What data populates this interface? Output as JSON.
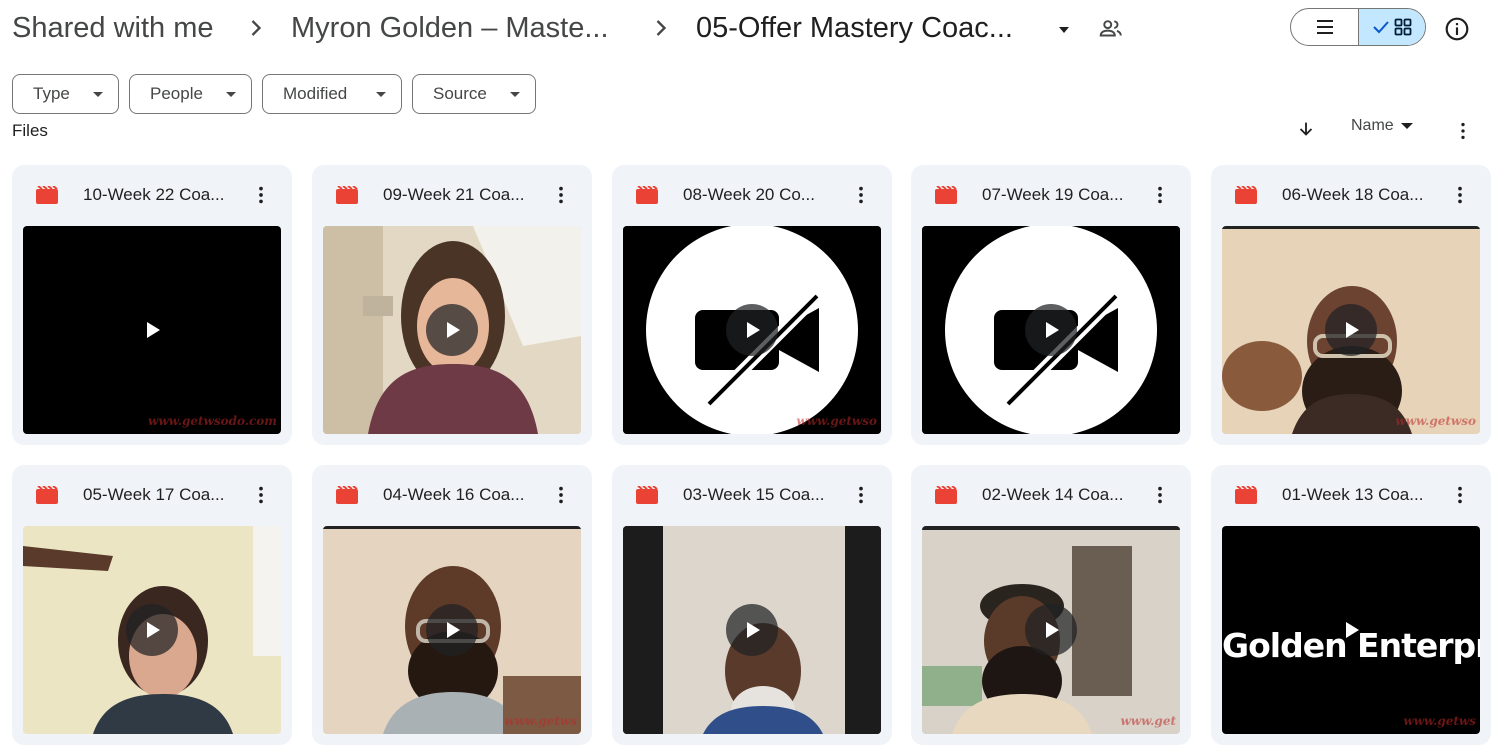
{
  "breadcrumb": {
    "root": "Shared with me",
    "parent": "Myron Golden – Maste...",
    "current": "05-Offer Mastery Coac..."
  },
  "filters": [
    "Type",
    "People",
    "Modified",
    "Source"
  ],
  "section_label": "Files",
  "sort": {
    "field": "Name"
  },
  "colors": {
    "accent_selected": "#c2e7ff",
    "card_bg": "#f0f4f9",
    "video_icon": "#ea4335"
  },
  "files": [
    {
      "title": "10-Week 22 Coa...",
      "watermark": "www.getwsodo.com"
    },
    {
      "title": "09-Week 21 Coa...",
      "watermark": ""
    },
    {
      "title": "08-Week 20 Co...",
      "watermark": "www.getwso"
    },
    {
      "title": "07-Week 19 Coa...",
      "watermark": ""
    },
    {
      "title": "06-Week 18 Coa...",
      "watermark": "www.getwso"
    },
    {
      "title": "05-Week 17 Coa...",
      "watermark": ""
    },
    {
      "title": "04-Week 16 Coa...",
      "watermark": "www.getws"
    },
    {
      "title": "03-Week 15 Coa...",
      "watermark": ""
    },
    {
      "title": "02-Week 14 Coa...",
      "watermark": "www.get"
    },
    {
      "title": "01-Week 13 Coa...",
      "watermark": "www.getws",
      "thumb_text": "Golden Enterprises"
    }
  ]
}
